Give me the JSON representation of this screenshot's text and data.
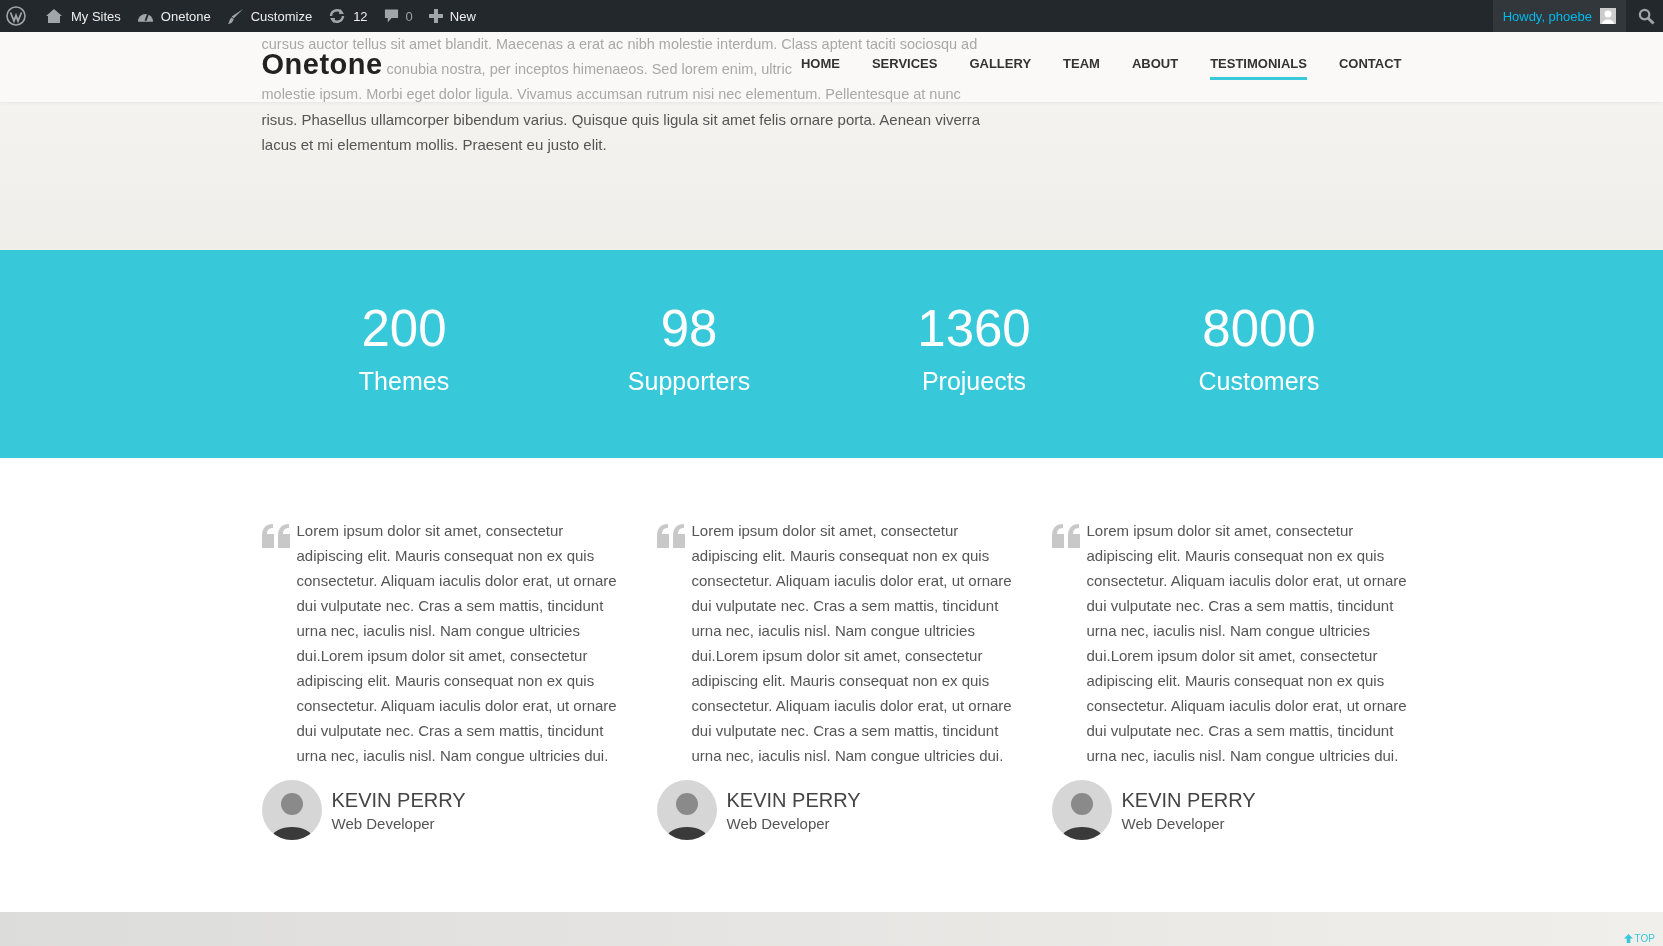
{
  "admin_bar": {
    "items": [
      {
        "kind": "sites",
        "label": "My Sites"
      },
      {
        "kind": "dashboard",
        "label": "Onetone"
      },
      {
        "kind": "brush",
        "label": "Customize"
      },
      {
        "kind": "updates",
        "label": "12"
      },
      {
        "kind": "comments",
        "label": "0"
      },
      {
        "kind": "new",
        "label": "New"
      }
    ],
    "greeting": "Howdy, phoebe"
  },
  "header": {
    "logo": "Onetone",
    "nav": [
      {
        "label": "HOME",
        "selected": false
      },
      {
        "label": "SERVICES",
        "selected": false
      },
      {
        "label": "GALLERY",
        "selected": false
      },
      {
        "label": "TEAM",
        "selected": false
      },
      {
        "label": "ABOUT",
        "selected": false
      },
      {
        "label": "TESTIMONIALS",
        "selected": true
      },
      {
        "label": "CONTACT",
        "selected": false
      }
    ]
  },
  "hero": {
    "faded_lines": [
      "cursus auctor tellus sit amet blandit. Maecenas a erat ac nibh molestie interdum. Class aptent taciti sociosqu ad",
      "conubia nostra, per inceptos himenaeos. Sed lorem enim, ultric",
      "molestie ipsum. Morbi eget dolor ligula. Vivamus accumsan rutrum nisi nec elementum. Pellentesque at nunc"
    ],
    "text": "risus. Phasellus ullamcorper bibendum varius. Quisque quis ligula sit amet felis ornare porta. Aenean viverra lacus et mi elementum mollis. Praesent eu justo elit."
  },
  "stats": [
    {
      "number": "200",
      "label": "Themes"
    },
    {
      "number": "98",
      "label": "Supporters"
    },
    {
      "number": "1360",
      "label": "Projuects"
    },
    {
      "number": "8000",
      "label": "Customers"
    }
  ],
  "testimonials": [
    {
      "text": "Lorem ipsum dolor sit amet, consectetur adipiscing elit. Mauris consequat non ex quis consectetur. Aliquam iaculis dolor erat, ut ornare dui vulputate nec. Cras a sem mattis, tincidunt urna nec, iaculis nisl. Nam congue ultricies dui.Lorem ipsum dolor sit amet, consectetur adipiscing elit. Mauris consequat non ex quis consectetur. Aliquam iaculis dolor erat, ut ornare dui vulputate nec. Cras a sem mattis, tincidunt urna nec, iaculis nisl. Nam congue ultricies dui.",
      "name": "KEVIN PERRY",
      "role": "Web Developer"
    },
    {
      "text": "Lorem ipsum dolor sit amet, consectetur adipiscing elit. Mauris consequat non ex quis consectetur. Aliquam iaculis dolor erat, ut ornare dui vulputate nec. Cras a sem mattis, tincidunt urna nec, iaculis nisl. Nam congue ultricies dui.Lorem ipsum dolor sit amet, consectetur adipiscing elit. Mauris consequat non ex quis consectetur. Aliquam iaculis dolor erat, ut ornare dui vulputate nec. Cras a sem mattis, tincidunt urna nec, iaculis nisl. Nam congue ultricies dui.",
      "name": "KEVIN PERRY",
      "role": "Web Developer"
    },
    {
      "text": "Lorem ipsum dolor sit amet, consectetur adipiscing elit. Mauris consequat non ex quis consectetur. Aliquam iaculis dolor erat, ut ornare dui vulputate nec. Cras a sem mattis, tincidunt urna nec, iaculis nisl. Nam congue ultricies dui.Lorem ipsum dolor sit amet, consectetur adipiscing elit. Mauris consequat non ex quis consectetur. Aliquam iaculis dolor erat, ut ornare dui vulputate nec. Cras a sem mattis, tincidunt urna nec, iaculis nisl. Nam congue ultricies dui.",
      "name": "KEVIN PERRY",
      "role": "Web Developer"
    }
  ],
  "footer": {
    "top_link": "TOP"
  }
}
